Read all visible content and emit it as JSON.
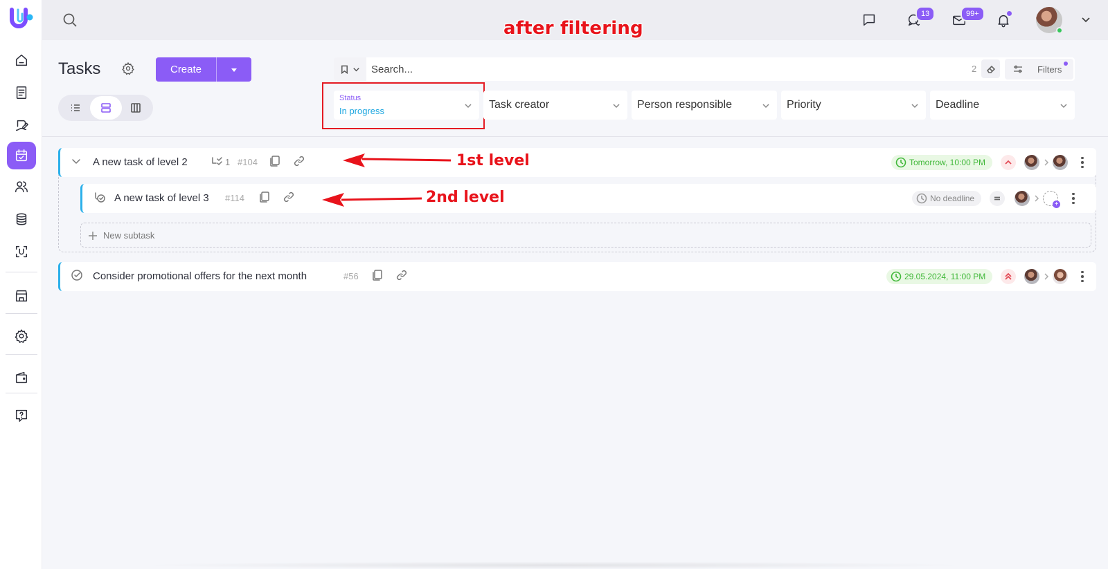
{
  "sidebar": {
    "logo": "U",
    "items": [
      {
        "icon": "home-icon"
      },
      {
        "icon": "document-icon"
      },
      {
        "icon": "pen-sign-icon"
      },
      {
        "icon": "calendar-check-icon",
        "active": true
      },
      {
        "icon": "users-icon"
      },
      {
        "icon": "database-icon"
      },
      {
        "icon": "scan-icon"
      },
      {
        "icon": "store-icon"
      },
      {
        "icon": "gear-icon"
      },
      {
        "icon": "wallet-icon"
      },
      {
        "icon": "help-icon"
      }
    ]
  },
  "topbar": {
    "chat_badge": "13",
    "mail_badge": "99+",
    "annotation": "after filtering"
  },
  "header": {
    "title": "Tasks",
    "create_label": "Create"
  },
  "search": {
    "placeholder": "Search...",
    "count": "2",
    "filters_label": "Filters"
  },
  "filters": {
    "status_label": "Status",
    "status_value": "In progress",
    "task_creator": "Task creator",
    "person_responsible": "Person responsible",
    "priority": "Priority",
    "deadline": "Deadline"
  },
  "tasks": [
    {
      "name": "A new task of level 2",
      "subtask_count": "1",
      "id": "#104",
      "deadline": "Tomorrow, 10:00 PM",
      "priority": "high",
      "annotation": "1st level",
      "subtasks": [
        {
          "name": "A new task of level 3",
          "id": "#114",
          "deadline": "No deadline",
          "priority": "normal",
          "annotation": "2nd level"
        }
      ],
      "new_subtask_label": "New subtask"
    },
    {
      "name": "Consider promotional offers for the next month",
      "id": "#56",
      "deadline": "29.05.2024, 11:00 PM",
      "priority": "highest"
    }
  ],
  "colors": {
    "accent": "#8b5cf6",
    "task_border": "#2cb0ea",
    "deadline_green": "#41b83a",
    "annotation_red": "#e8131b"
  }
}
